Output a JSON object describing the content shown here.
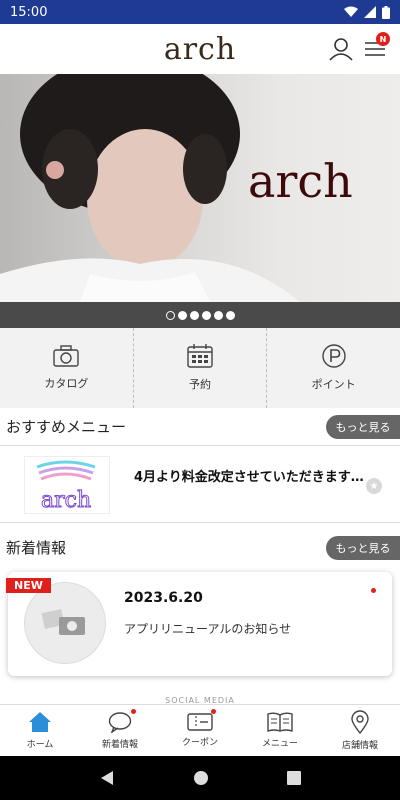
{
  "status_bar": {
    "time": "15:00"
  },
  "header": {
    "logo": "arch",
    "badge": "N"
  },
  "hero": {
    "overlay_text": "arch",
    "slides": 6,
    "active_slide": 0
  },
  "quick_menu": [
    {
      "label": "カタログ",
      "icon": "camera-icon"
    },
    {
      "label": "予約",
      "icon": "calendar-icon"
    },
    {
      "label": "ポイント",
      "icon": "points-icon"
    }
  ],
  "recommended": {
    "title": "おすすめメニュー",
    "more_label": "もっと見る",
    "item_text": "4月より料金改定させていただきます…"
  },
  "news": {
    "title": "新着情報",
    "more_label": "もっと見る",
    "new_badge": "NEW",
    "date": "2023.6.20",
    "body": "アプリリニューアルのお知らせ"
  },
  "social_label": "SOCIAL MEDIA",
  "bottom_nav": [
    {
      "label": "ホーム",
      "icon": "home-icon",
      "active": true
    },
    {
      "label": "新着情報",
      "icon": "chat-icon"
    },
    {
      "label": "クーポン",
      "icon": "coupon-icon"
    },
    {
      "label": "メニュー",
      "icon": "book-icon"
    },
    {
      "label": "店舗情報",
      "icon": "location-icon"
    }
  ],
  "colors": {
    "status_bar": "#1f3a93",
    "accent_red": "#e0211b",
    "active_nav": "#2a8fd6"
  }
}
